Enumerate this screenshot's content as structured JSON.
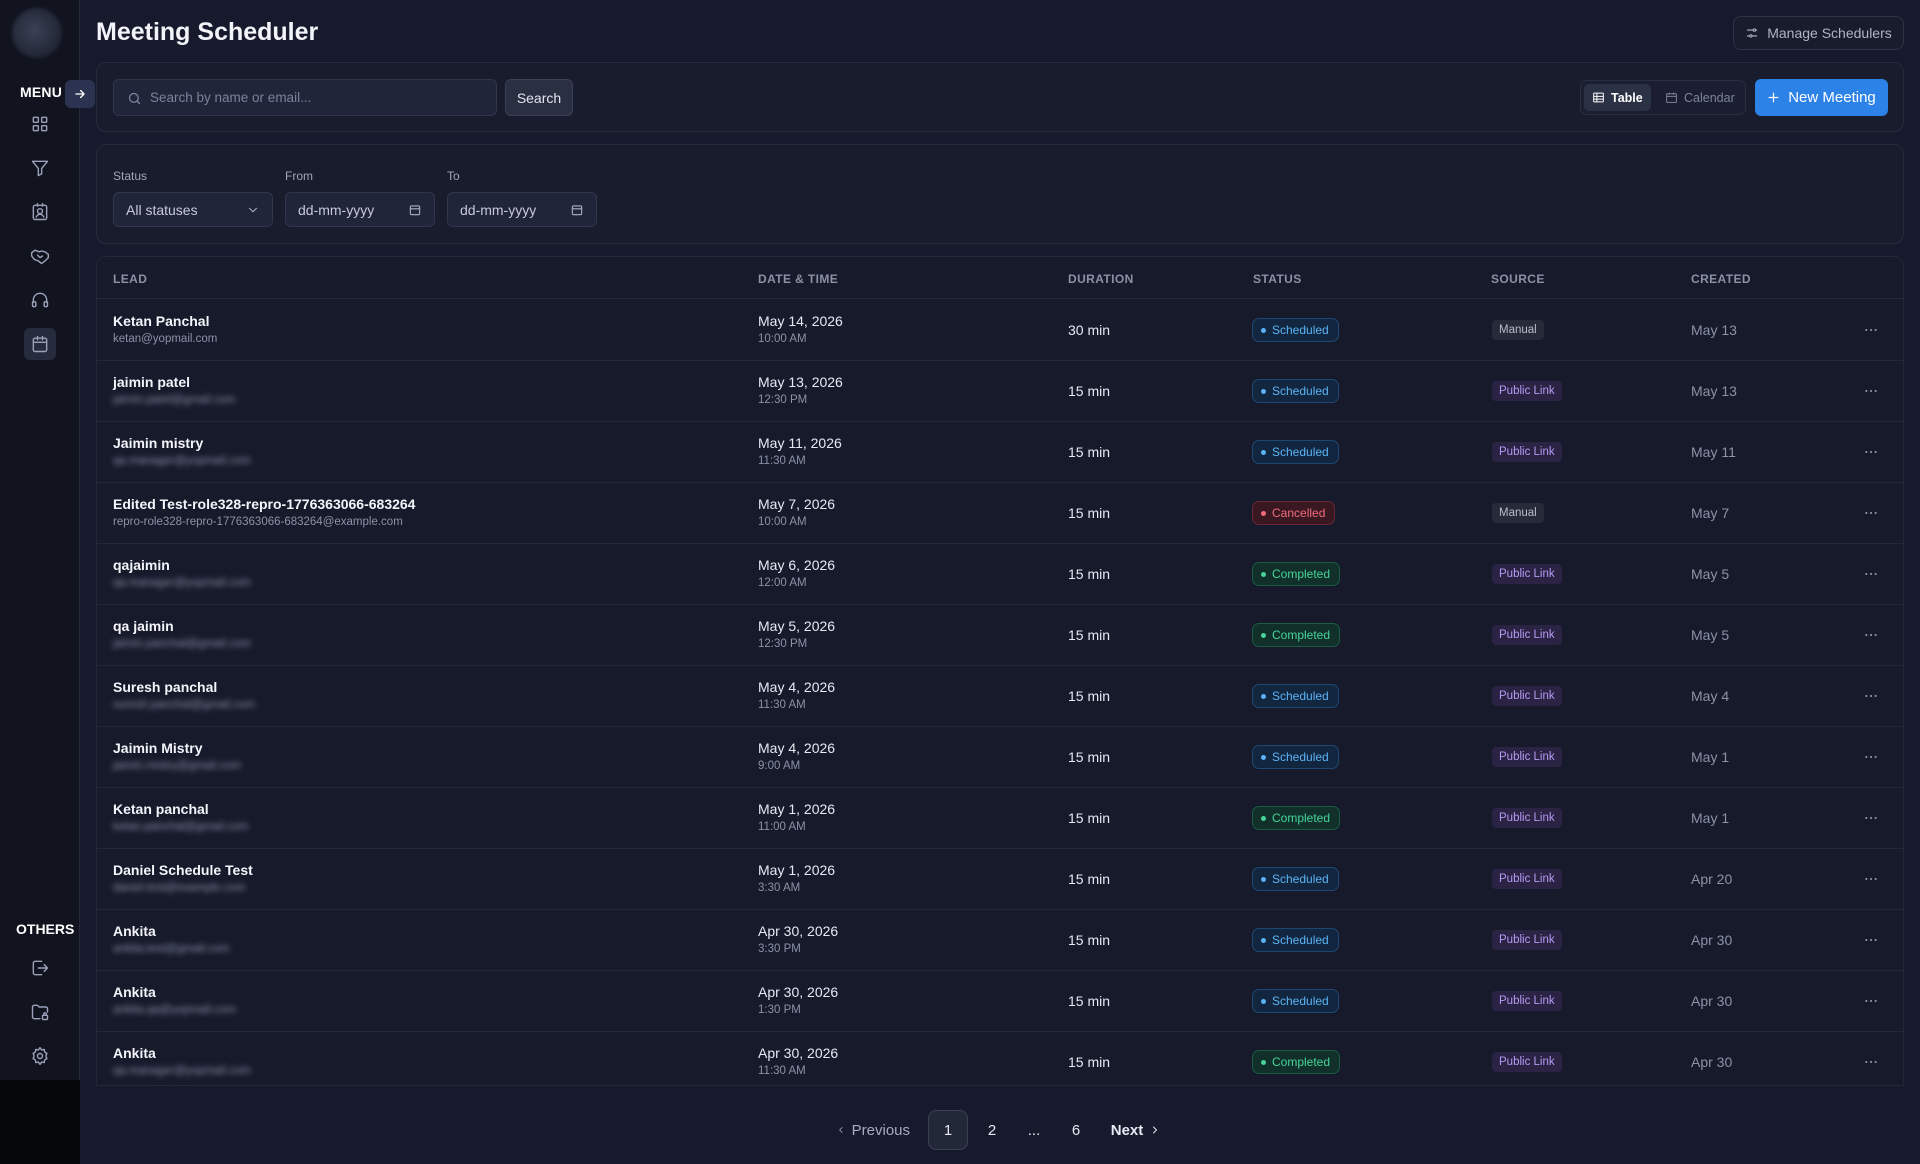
{
  "sidebar": {
    "menu_label": "MENU",
    "others_label": "OTHERS",
    "nav_icons": [
      "dashboard-grid-icon",
      "funnel-icon",
      "contacts-icon",
      "handshake-icon",
      "headset-icon",
      "calendar-icon"
    ],
    "other_icons": [
      "logout-icon",
      "folder-lock-icon",
      "gear-icon"
    ]
  },
  "header": {
    "title": "Meeting Scheduler",
    "manage_label": "Manage Schedulers"
  },
  "toolbar": {
    "search_placeholder": "Search by name or email...",
    "search_label": "Search",
    "view_table": "Table",
    "view_calendar": "Calendar",
    "new_meeting_label": "New Meeting"
  },
  "filters": {
    "status_label": "Status",
    "status_value": "All statuses",
    "from_label": "From",
    "from_placeholder": "dd-mm-yyyy",
    "to_label": "To",
    "to_placeholder": "dd-mm-yyyy"
  },
  "table": {
    "headers": [
      "LEAD",
      "DATE & TIME",
      "DURATION",
      "STATUS",
      "SOURCE",
      "CREATED"
    ],
    "rows": [
      {
        "name": "Ketan Panchal",
        "email": "ketan@yopmail.com",
        "blur": false,
        "date": "May 14, 2026",
        "time": "10:00 AM",
        "duration": "30 min",
        "status": "Scheduled",
        "source": "Manual",
        "created": "May 13"
      },
      {
        "name": "jaimin patel",
        "email": "jaimin.patel@gmail.com",
        "blur": true,
        "date": "May 13, 2026",
        "time": "12:30 PM",
        "duration": "15 min",
        "status": "Scheduled",
        "source": "Public Link",
        "created": "May 13"
      },
      {
        "name": "Jaimin mistry",
        "email": "qa.manager@yopmail.com",
        "blur": true,
        "date": "May 11, 2026",
        "time": "11:30 AM",
        "duration": "15 min",
        "status": "Scheduled",
        "source": "Public Link",
        "created": "May 11"
      },
      {
        "name": "Edited Test-role328-repro-1776363066-683264",
        "email": "repro-role328-repro-1776363066-683264@example.com",
        "blur": false,
        "date": "May 7, 2026",
        "time": "10:00 AM",
        "duration": "15 min",
        "status": "Cancelled",
        "source": "Manual",
        "created": "May 7"
      },
      {
        "name": "qajaimin",
        "email": "qa.manager@yopmail.com",
        "blur": true,
        "date": "May 6, 2026",
        "time": "12:00 AM",
        "duration": "15 min",
        "status": "Completed",
        "source": "Public Link",
        "created": "May 5"
      },
      {
        "name": "qa jaimin",
        "email": "jaimin.panchal@gmail.com",
        "blur": true,
        "date": "May 5, 2026",
        "time": "12:30 PM",
        "duration": "15 min",
        "status": "Completed",
        "source": "Public Link",
        "created": "May 5"
      },
      {
        "name": "Suresh panchal",
        "email": "suresh.panchal@gmail.com",
        "blur": true,
        "date": "May 4, 2026",
        "time": "11:30 AM",
        "duration": "15 min",
        "status": "Scheduled",
        "source": "Public Link",
        "created": "May 4"
      },
      {
        "name": "Jaimin Mistry",
        "email": "jaimin.mistry@gmail.com",
        "blur": true,
        "date": "May 4, 2026",
        "time": "9:00 AM",
        "duration": "15 min",
        "status": "Scheduled",
        "source": "Public Link",
        "created": "May 1"
      },
      {
        "name": "Ketan panchal",
        "email": "ketan.panchal@gmail.com",
        "blur": true,
        "date": "May 1, 2026",
        "time": "11:00 AM",
        "duration": "15 min",
        "status": "Completed",
        "source": "Public Link",
        "created": "May 1"
      },
      {
        "name": "Daniel Schedule Test",
        "email": "daniel.test@example.com",
        "blur": true,
        "date": "May 1, 2026",
        "time": "3:30 AM",
        "duration": "15 min",
        "status": "Scheduled",
        "source": "Public Link",
        "created": "Apr 20"
      },
      {
        "name": "Ankita",
        "email": "ankita.test@gmail.com",
        "blur": true,
        "date": "Apr 30, 2026",
        "time": "3:30 PM",
        "duration": "15 min",
        "status": "Scheduled",
        "source": "Public Link",
        "created": "Apr 30"
      },
      {
        "name": "Ankita",
        "email": "ankita.qa@yopmail.com",
        "blur": true,
        "date": "Apr 30, 2026",
        "time": "1:30 PM",
        "duration": "15 min",
        "status": "Scheduled",
        "source": "Public Link",
        "created": "Apr 30"
      },
      {
        "name": "Ankita",
        "email": "qa.manager@yopmail.com",
        "blur": true,
        "date": "Apr 30, 2026",
        "time": "11:30 AM",
        "duration": "15 min",
        "status": "Completed",
        "source": "Public Link",
        "created": "Apr 30"
      }
    ]
  },
  "pagination": {
    "previous": "Previous",
    "pages": [
      "1",
      "2",
      "...",
      "6"
    ],
    "current": "1",
    "next": "Next"
  },
  "colors": {
    "accent": "#2c82e6",
    "scheduled": "#5bb3f5",
    "completed": "#46d49a",
    "cancelled": "#f16b7c",
    "public_link": "#b79af3"
  }
}
